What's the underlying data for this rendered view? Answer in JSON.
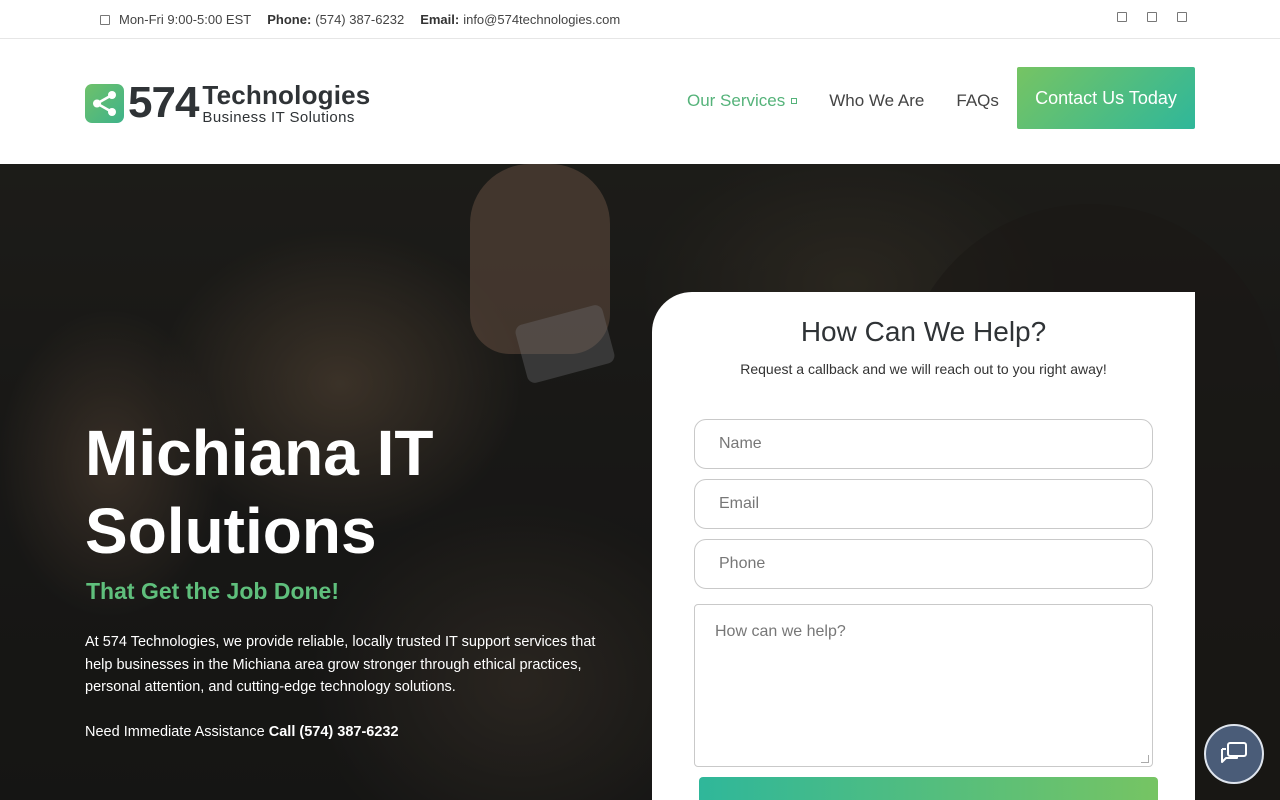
{
  "topbar": {
    "hours": "Mon-Fri 9:00-5:00 EST",
    "phone_label": "Phone:",
    "phone": "(574) 387-6232",
    "email_label": "Email:",
    "email": "info@574technologies.com"
  },
  "logo": {
    "number": "574",
    "name": "Technologies",
    "tagline": "Business IT Solutions"
  },
  "nav": {
    "items": [
      {
        "label": "Our Services",
        "active": true
      },
      {
        "label": "Who We Are"
      },
      {
        "label": "FAQs"
      }
    ],
    "cta": "Contact Us Today"
  },
  "hero": {
    "title": "Michiana IT Solutions",
    "tagline": "That Get the Job Done!",
    "paragraph": "At 574 Technologies, we provide reliable, locally trusted IT support services that help businesses in the Michiana area grow stronger through ethical practices, personal attention, and cutting-edge technology solutions.",
    "need_text": "Need Immediate Assistance",
    "call_text": "Call (574) 387-6232"
  },
  "form": {
    "title": "How Can We Help?",
    "subtitle": "Request a callback and we will reach out to you right away!",
    "name_placeholder": "Name",
    "email_placeholder": "Email",
    "phone_placeholder": "Phone",
    "message_placeholder": "How can we help?"
  },
  "colors": {
    "accent_green": "#5fbf7c",
    "gradient_start": "#76c463",
    "gradient_end": "#2fb79a",
    "chat_bubble": "#4a5c78"
  },
  "icons": {
    "clock": "clock-icon",
    "social": [
      "facebook-icon",
      "linkedin-icon",
      "instagram-icon"
    ],
    "chat": "chat-icon"
  }
}
